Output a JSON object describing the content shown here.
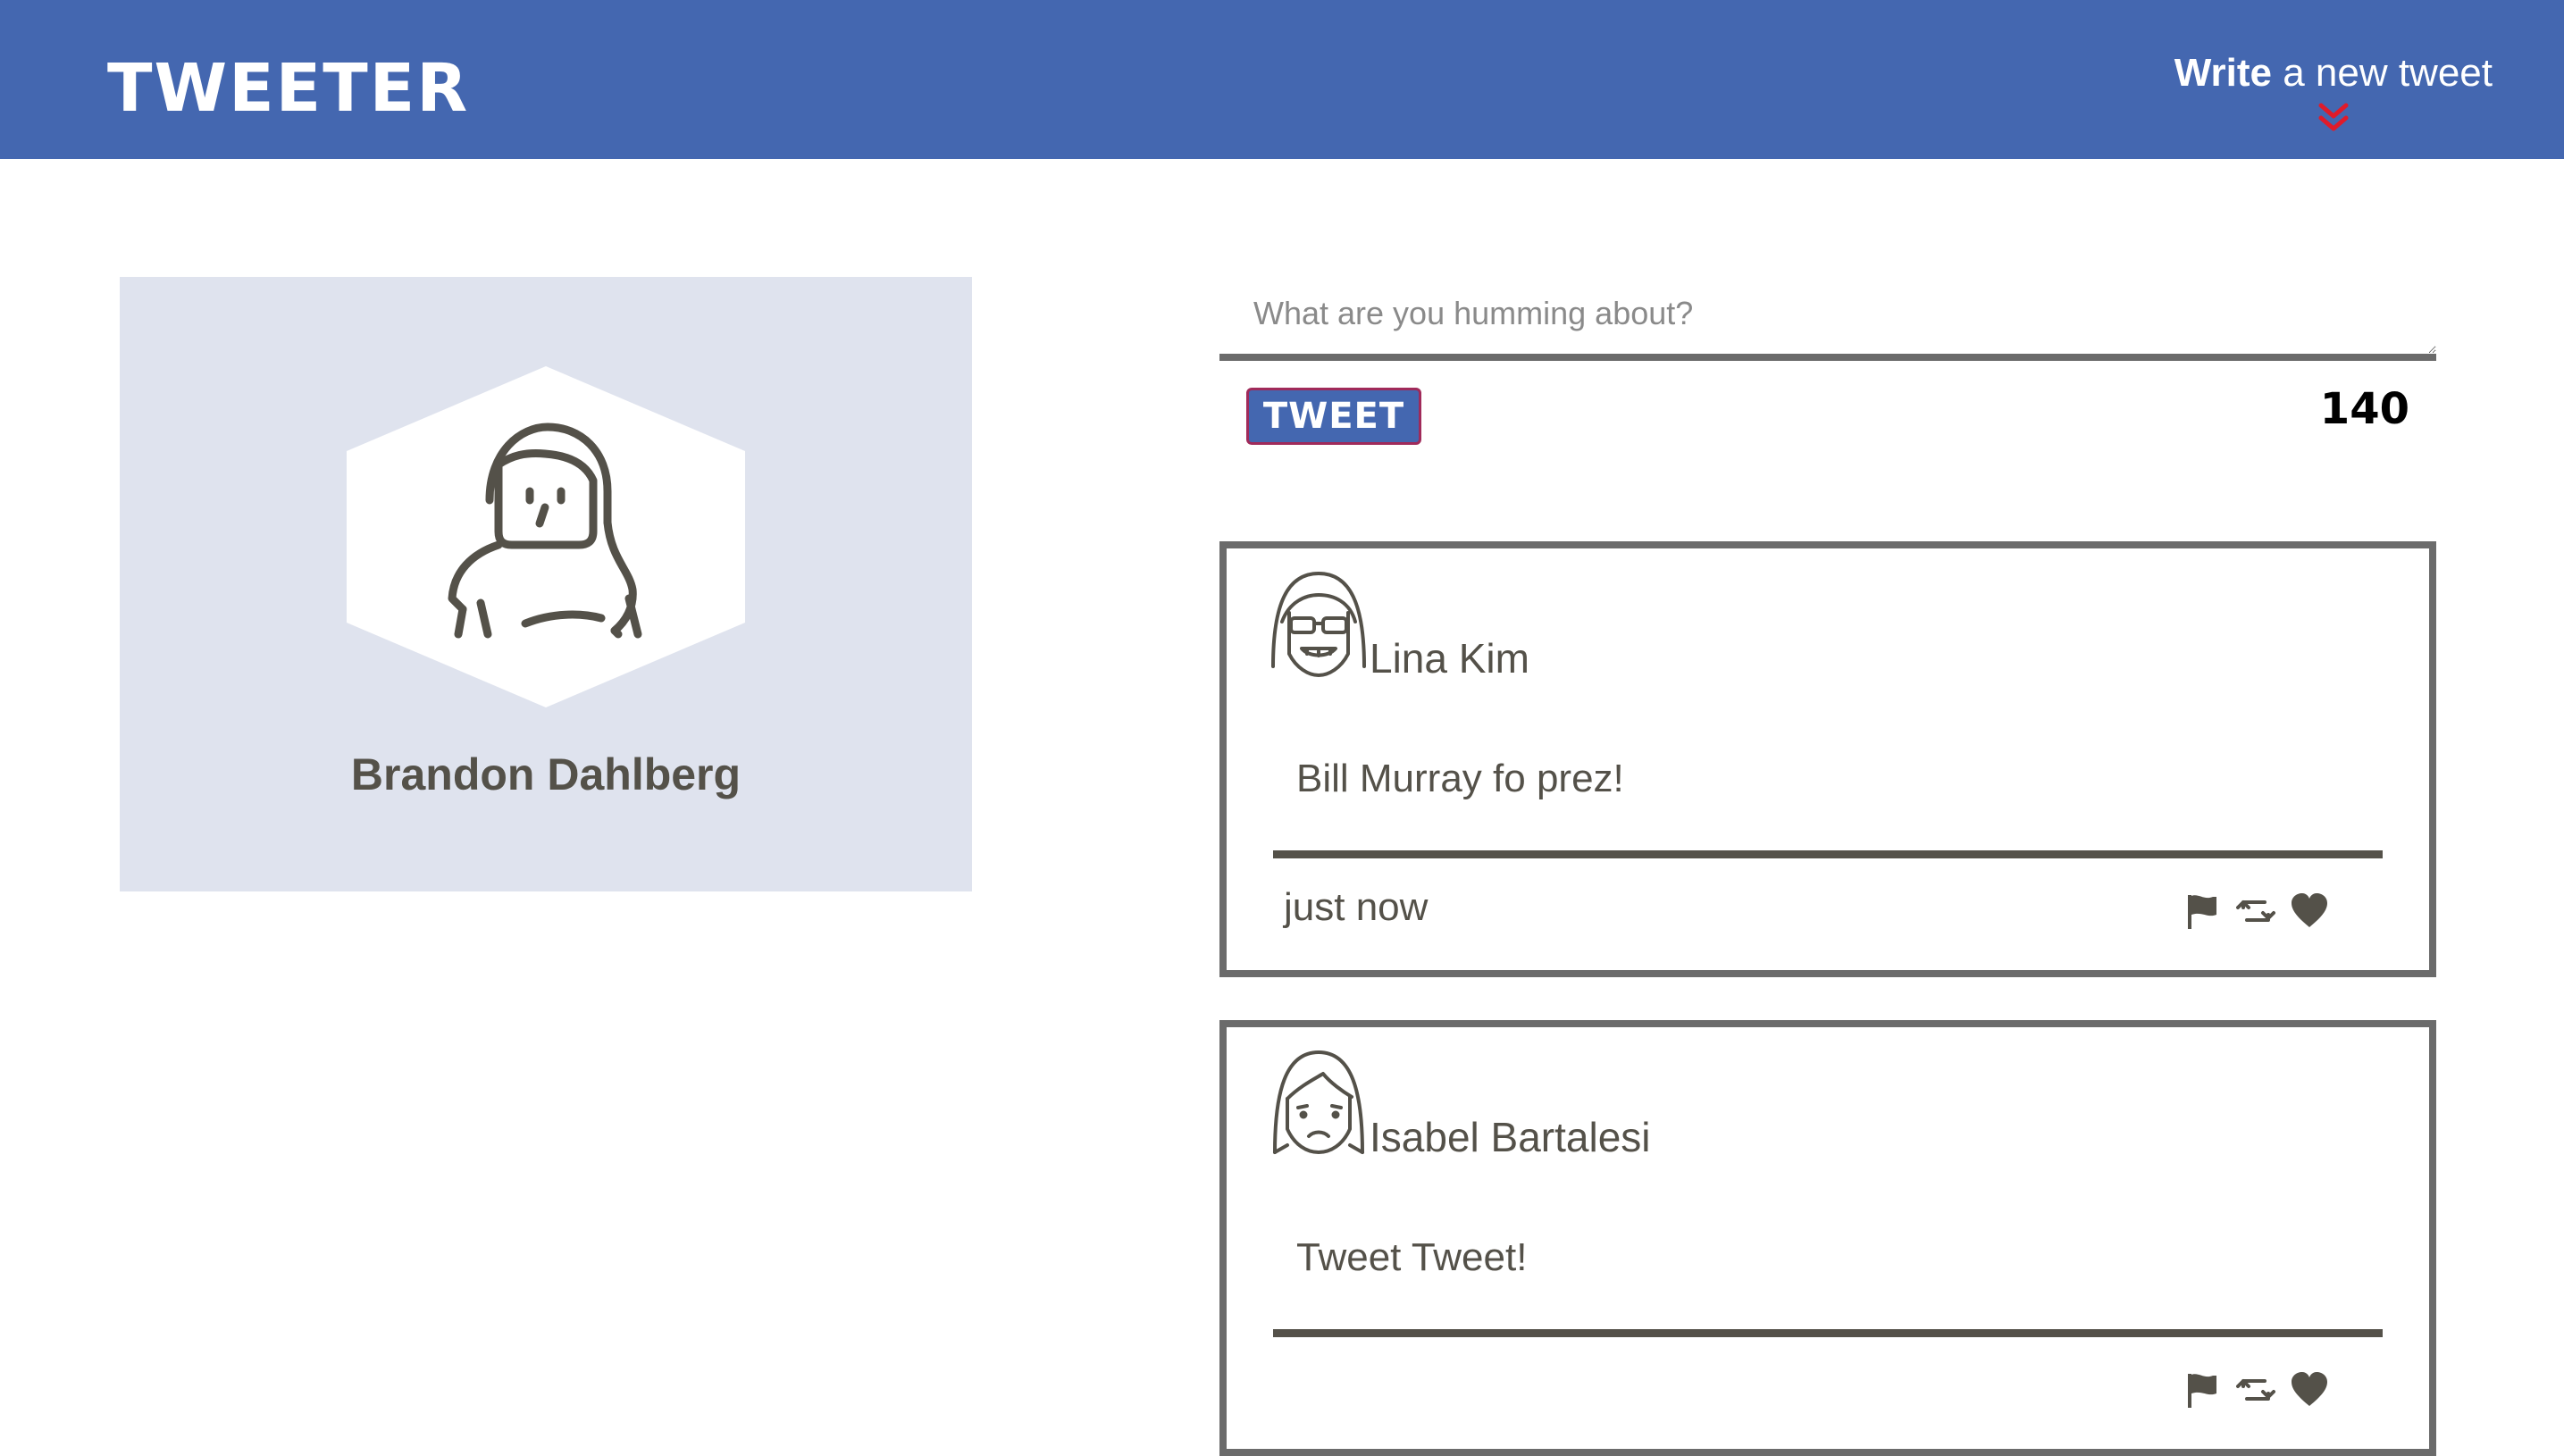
{
  "nav": {
    "logo": "TWEETER",
    "compose_strong": "Write",
    "compose_rest": " a new tweet",
    "chevron_color": "#e01b2a"
  },
  "profile": {
    "name": "Brandon Dahlberg",
    "avatar_icon": "user-avatar-icon"
  },
  "composer": {
    "placeholder": "What are you humming about?",
    "value": "",
    "submit_label": "TWEET",
    "counter": "140"
  },
  "tweets": [
    {
      "author": "Lina Kim",
      "avatar_icon": "avatar-sunglasses-icon",
      "content": "Bill Murray fo prez!",
      "time": "just now",
      "actions": [
        "flag-icon",
        "retweet-icon",
        "heart-icon"
      ]
    },
    {
      "author": "Isabel Bartalesi",
      "avatar_icon": "avatar-frown-icon",
      "content": "Tweet Tweet!",
      "time": "",
      "actions": [
        "flag-icon",
        "retweet-icon",
        "heart-icon"
      ]
    }
  ],
  "colors": {
    "header_bg": "#4467b0",
    "profile_bg": "#dfe3ee",
    "text": "#545149",
    "border": "#6b6b6b"
  }
}
